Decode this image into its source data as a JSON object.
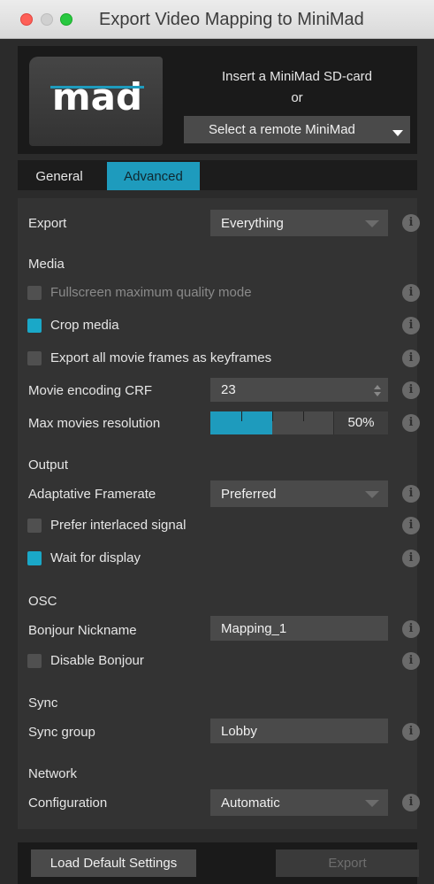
{
  "window": {
    "title": "Export Video Mapping to MiniMad"
  },
  "header": {
    "logo_text": "mad",
    "insert_text": "Insert a MiniMad SD-card",
    "or_text": "or",
    "remote_select": "Select a remote MiniMad"
  },
  "tabs": [
    {
      "label": "General",
      "active": false
    },
    {
      "label": "Advanced",
      "active": true
    }
  ],
  "settings": {
    "export": {
      "label": "Export",
      "value": "Everything"
    },
    "media_section": "Media",
    "fullscreen": {
      "label": "Fullscreen maximum quality mode",
      "checked": false,
      "enabled": false
    },
    "crop_media": {
      "label": "Crop media",
      "checked": true
    },
    "keyframes": {
      "label": "Export all movie frames as keyframes",
      "checked": false
    },
    "crf": {
      "label": "Movie encoding CRF",
      "value": "23"
    },
    "resolution": {
      "label": "Max movies resolution",
      "value": "50%",
      "level": 0.5
    },
    "output_section": "Output",
    "framerate": {
      "label": "Adaptative Framerate",
      "value": "Preferred"
    },
    "interlaced": {
      "label": "Prefer interlaced signal",
      "checked": false
    },
    "wait_display": {
      "label": "Wait for display",
      "checked": true
    },
    "osc_section": "OSC",
    "bonjour_nick": {
      "label": "Bonjour Nickname",
      "value": "Mapping_1"
    },
    "disable_bonjour": {
      "label": "Disable Bonjour",
      "checked": false
    },
    "sync_section": "Sync",
    "sync_group": {
      "label": "Sync group",
      "value": "Lobby"
    },
    "network_section": "Network",
    "configuration": {
      "label": "Configuration",
      "value": "Automatic"
    }
  },
  "info_glyph": "i",
  "footer": {
    "load_defaults": "Load Default Settings",
    "export": "Export"
  },
  "colors": {
    "accent": "#1e9bbd",
    "background": "#333333"
  }
}
